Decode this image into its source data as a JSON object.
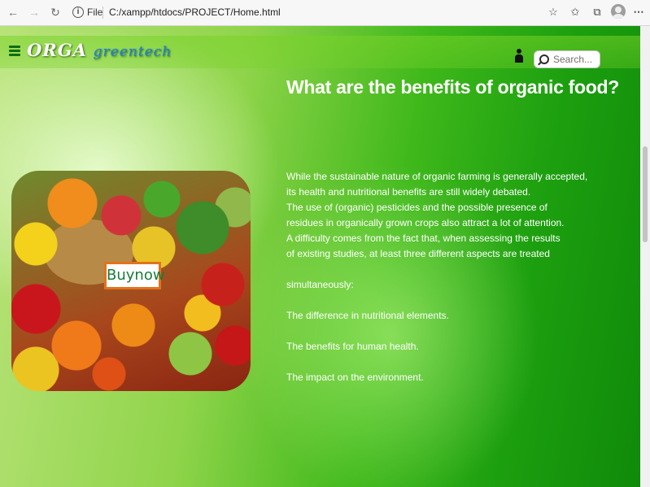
{
  "browser": {
    "address_scheme": "File",
    "address_url": "C:/xampp/htdocs/PROJECT/Home.html"
  },
  "header": {
    "logo_primary": "ORGA",
    "logo_secondary": "greentech",
    "search_placeholder": "Search..."
  },
  "main": {
    "headline": "What are the benefits of organic food?",
    "buy_button_label": "Buynow",
    "paragraph_lines": [
      "While the sustainable nature of organic farming is generally accepted,",
      "its health and nutritional benefits are still widely debated.",
      "The use of (organic) pesticides and the possible presence of",
      "residues in organically grown crops also attract a lot of attention.",
      "A difficulty comes from the fact that, when assessing the results",
      "of existing studies, at least three different aspects are treated"
    ],
    "simultaneously": "simultaneously:",
    "aspects": [
      "The difference in nutritional elements.",
      "The benefits for human health.",
      "The impact on the environment."
    ]
  },
  "icons": {
    "back": "arrow-left",
    "forward": "arrow-right",
    "refresh": "refresh",
    "menu": "hamburger",
    "user": "person",
    "search": "magnifier"
  },
  "colors": {
    "accent_green": "#1c9f0f",
    "logo_blue": "#1b7ee3",
    "button_border": "#e2731d",
    "button_text": "#187b3a"
  }
}
